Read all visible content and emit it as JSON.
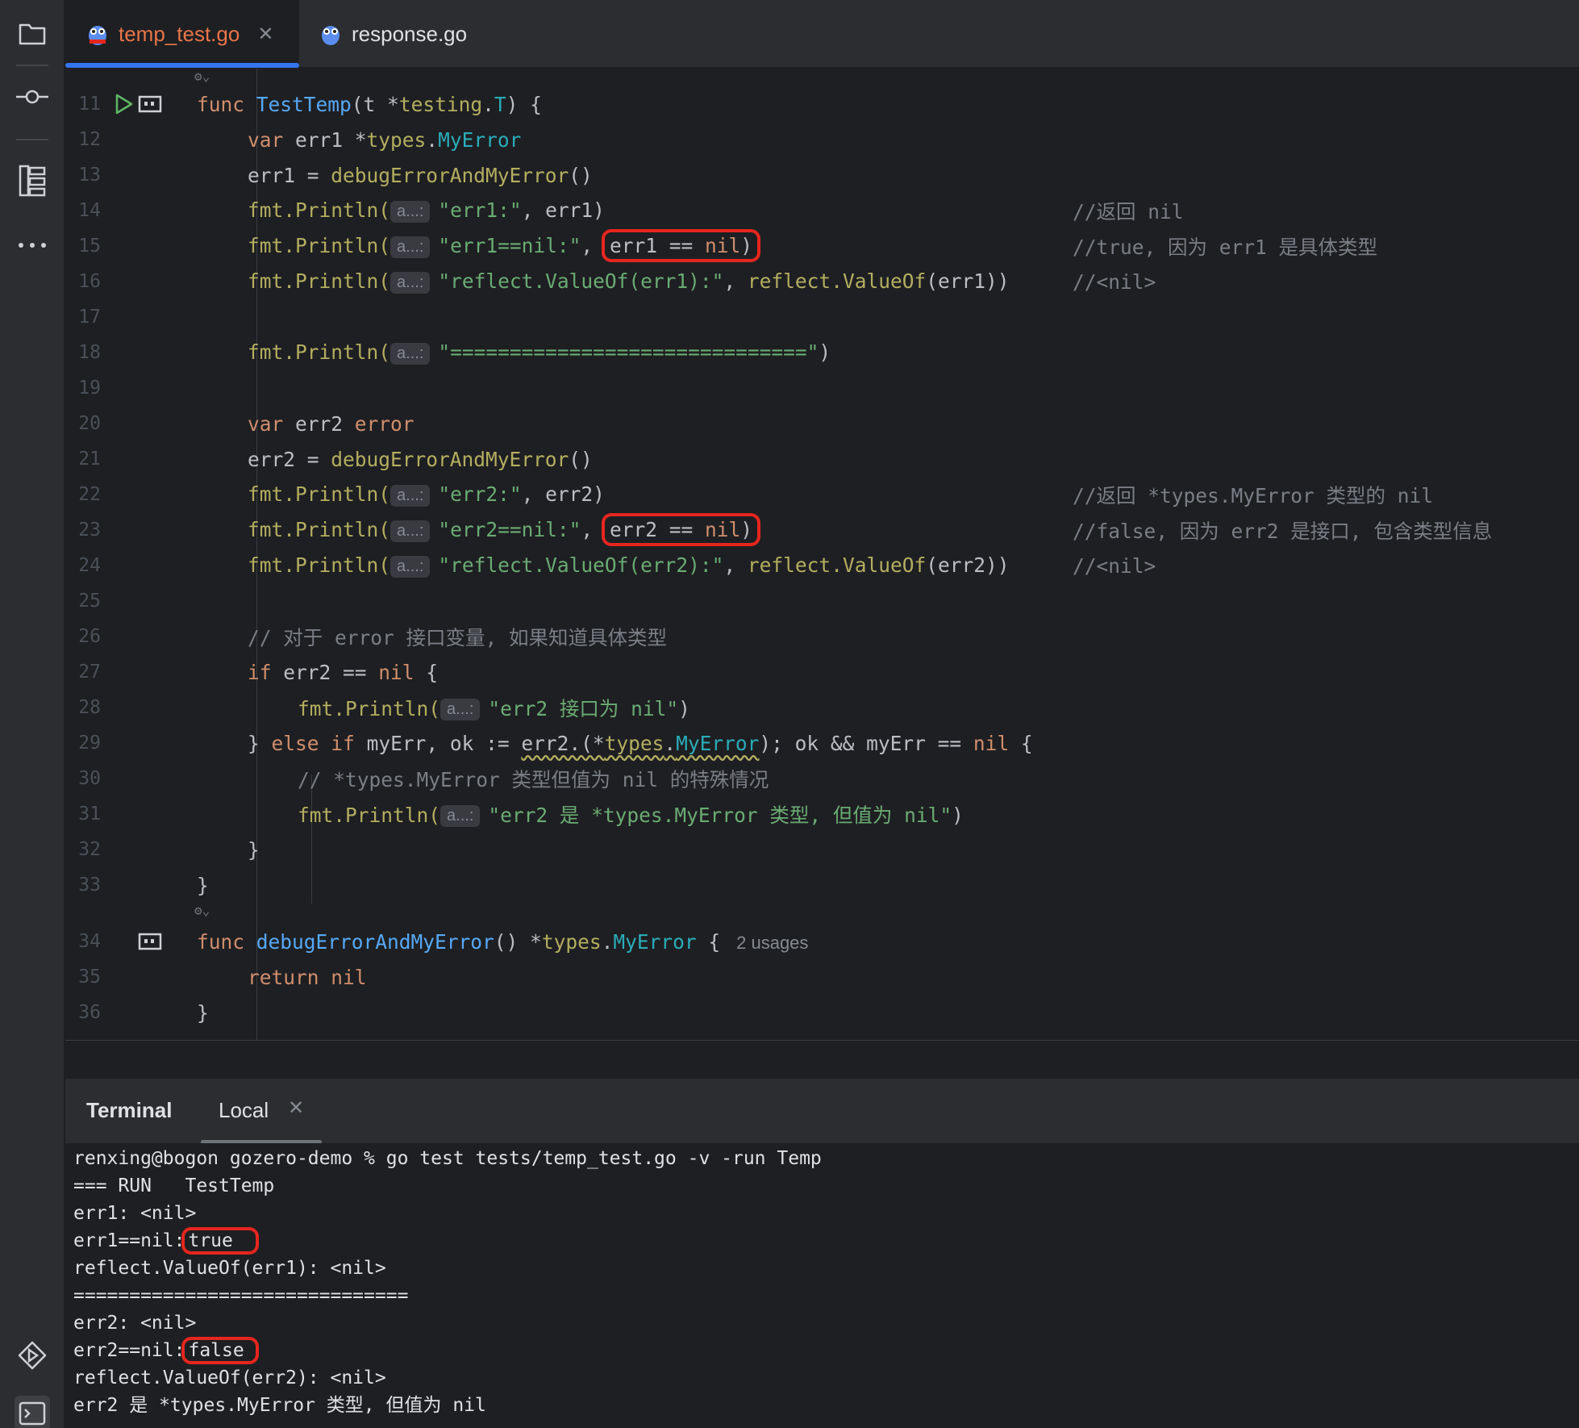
{
  "tabs": [
    {
      "label": "temp_test.go",
      "active": true,
      "color": "#e8754a"
    },
    {
      "label": "response.go",
      "active": false,
      "color": "#dfe1e5"
    }
  ],
  "param_hint": "a...:",
  "usages": "2 usages",
  "code": {
    "l11": {
      "num": "11",
      "func": "func",
      "name": "TestTemp",
      "rest1": "(t *",
      "pkg": "testing",
      "dot": ".",
      "type": "T",
      "rest2": ") {"
    },
    "l12": {
      "num": "12",
      "var": "var",
      "rest1": " err1 *",
      "pkg": "types",
      "dot": ".",
      "type": "MyError"
    },
    "l13": {
      "num": "13",
      "text": "err1 = ",
      "call": "debugErrorAndMyError",
      "tail": "()"
    },
    "l14": {
      "num": "14",
      "pkg": "fmt",
      "call": ".Println(",
      "str": "\"err1:\"",
      "tail": ", err1)",
      "comment": "//返回 nil"
    },
    "l15": {
      "num": "15",
      "pkg": "fmt",
      "call": ".Println(",
      "str": "\"err1==nil:\"",
      "sep": ",",
      "boxed_a": "err1 == ",
      "boxed_nil": "nil",
      "boxed_b": ")",
      "comment": "//true, 因为 err1 是具体类型"
    },
    "l16": {
      "num": "16",
      "pkg": "fmt",
      "call": ".Println(",
      "str": "\"reflect.ValueOf(err1):\"",
      "mid": ", ",
      "pkg2": "reflect",
      "call2": ".ValueOf",
      "tail": "(err1))",
      "comment": "//<nil>"
    },
    "l17": {
      "num": "17"
    },
    "l18": {
      "num": "18",
      "pkg": "fmt",
      "call": ".Println(",
      "str": "\"==============================\"",
      "tail": ")"
    },
    "l19": {
      "num": "19"
    },
    "l20": {
      "num": "20",
      "var": "var",
      "rest": " err2 ",
      "type": "error"
    },
    "l21": {
      "num": "21",
      "text": "err2 = ",
      "call": "debugErrorAndMyError",
      "tail": "()"
    },
    "l22": {
      "num": "22",
      "pkg": "fmt",
      "call": ".Println(",
      "str": "\"err2:\"",
      "tail": ", err2)",
      "comment": "//返回 *types.MyError 类型的 nil"
    },
    "l23": {
      "num": "23",
      "pkg": "fmt",
      "call": ".Println(",
      "str": "\"err2==nil:\"",
      "sep": ",",
      "boxed_a": "err2 == ",
      "boxed_nil": "nil",
      "boxed_b": ")",
      "comment": "//false, 因为 err2 是接口, 包含类型信息"
    },
    "l24": {
      "num": "24",
      "pkg": "fmt",
      "call": ".Println(",
      "str": "\"reflect.ValueOf(err2):\"",
      "mid": ", ",
      "pkg2": "reflect",
      "call2": ".ValueOf",
      "tail": "(err2))",
      "comment": "//<nil>"
    },
    "l25": {
      "num": "25"
    },
    "l26": {
      "num": "26",
      "comment": "// 对于 error 接口变量, 如果知道具体类型"
    },
    "l27": {
      "num": "27",
      "kw": "if",
      "mid": " err2 == ",
      "nil": "nil",
      "tail": " {"
    },
    "l28": {
      "num": "28",
      "pkg": "fmt",
      "call": ".Println(",
      "str": "\"err2 接口为 nil\"",
      "tail": ")"
    },
    "l29": {
      "num": "29",
      "a": "} ",
      "else": "else",
      "sp": " ",
      "if": "if",
      "b": " myErr, ok := ",
      "c": "err2.(*",
      "pkg": "types",
      "dot": ".",
      "type": "MyError",
      "d": "); ok && myErr == ",
      "nil": "nil",
      "e": " {"
    },
    "l30": {
      "num": "30",
      "comment": "// *types.MyError 类型但值为 nil 的特殊情况"
    },
    "l31": {
      "num": "31",
      "pkg": "fmt",
      "call": ".Println(",
      "str": "\"err2 是 *types.MyError 类型, 但值为 nil\"",
      "tail": ")"
    },
    "l32": {
      "num": "32",
      "text": "}"
    },
    "l33": {
      "num": "33",
      "text": "}"
    },
    "l34": {
      "num": "34",
      "func": "func",
      "name": "debugErrorAndMyError",
      "rest1": "() *",
      "pkg": "types",
      "dot": ".",
      "type": "MyError",
      "rest2": " {"
    },
    "l35": {
      "num": "35",
      "kw": "return",
      "nil": "nil"
    },
    "l36": {
      "num": "36",
      "text": "}"
    }
  },
  "terminal": {
    "title": "Terminal",
    "tab": "Local",
    "lines": {
      "cmd": "renxing@bogon gozero-demo % go test tests/temp_test.go -v -run Temp",
      "run": "=== RUN   TestTemp",
      "err1": "err1: <nil>",
      "err1nil_label": "err1==nil:",
      "err1nil_val": "true",
      "refl1": "reflect.ValueOf(err1): <nil>",
      "sep": "==============================",
      "err2": "err2: <nil>",
      "err2nil_label": "err2==nil:",
      "err2nil_val": "false",
      "refl2": "reflect.ValueOf(err2): <nil>",
      "last": "err2 是 *types.MyError 类型, 但值为 nil"
    }
  },
  "colors": {
    "accent": "#3574f0",
    "highlight_box": "#e5261f",
    "keyword": "#cf8e6d",
    "function": "#56a8f5",
    "string": "#6aab73",
    "comment": "#7a7e85"
  }
}
